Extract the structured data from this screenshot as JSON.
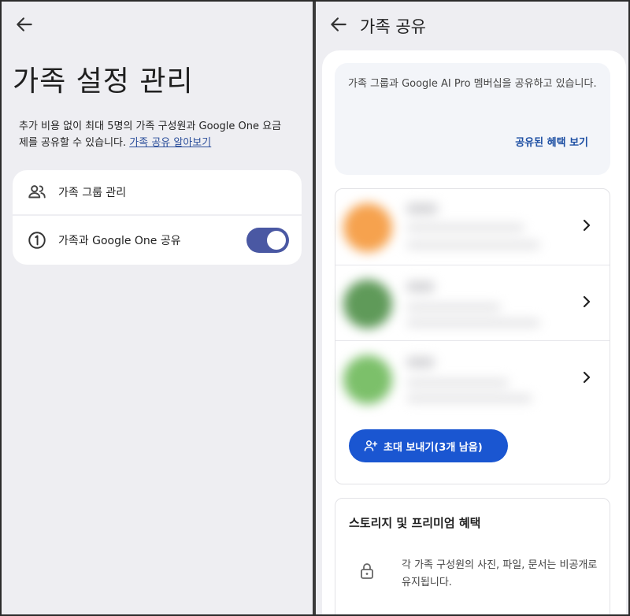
{
  "left": {
    "page_title": "가족 설정 관리",
    "description": "추가 비용 없이 최대 5명의 가족 구성원과 Google One 요금제를 공유할 수 있습니다.",
    "description_link": "가족 공유 알아보기",
    "settings": [
      {
        "label": "가족 그룹 관리",
        "icon": "people-icon"
      },
      {
        "label": "가족과 Google One 공유",
        "icon": "number-one-circle-icon",
        "toggle_on": true
      }
    ]
  },
  "right": {
    "title": "가족 공유",
    "info_text": "가족 그룹과 Google AI Pro 멤버십을 공유하고 있습니다.",
    "info_link": "공유된 혜택 보기",
    "members": [
      {
        "avatar_color": "#f6a24e"
      },
      {
        "avatar_color": "#5f9a59"
      },
      {
        "avatar_color": "#7cc06a"
      }
    ],
    "invite_button": "초대 보내기(3개 남음)",
    "storage": {
      "title": "스토리지 및 프리미엄 혜택",
      "text": "각 가족 구성원의 사진, 파일, 문서는 비공개로 유지됩니다."
    }
  },
  "colors": {
    "accent": "#1a56d1",
    "toggle": "#4a58a3",
    "link": "#1d4fa3",
    "background": "#eeeef2"
  }
}
